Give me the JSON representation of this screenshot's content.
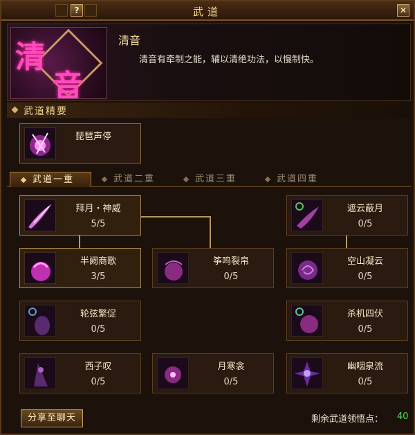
{
  "window": {
    "title": "武道",
    "help_label": "?",
    "close_label": "✕"
  },
  "header": {
    "emblem_chars": [
      "清",
      "音"
    ],
    "school_name": "清音",
    "description": "清音有牵制之能，辅以清绝功法，以慢制快。"
  },
  "section": {
    "title": "武道精要",
    "summary_skill": "琵琶声停"
  },
  "tabs": [
    {
      "label": "武道一重",
      "active": true
    },
    {
      "label": "武道二重",
      "active": false
    },
    {
      "label": "武道三重",
      "active": false
    },
    {
      "label": "武道四重",
      "active": false
    }
  ],
  "skills": [
    {
      "name": "拜月・神威",
      "level": "5/5",
      "icon": "crescent-slash-icon",
      "color": "#d040c0"
    },
    {
      "name": "遮云蔽月",
      "level": "0/5",
      "icon": "cloud-moon-icon",
      "color": "#a03090"
    },
    {
      "name": "半阙商歌",
      "level": "3/5",
      "icon": "magic-hand-icon",
      "color": "#c030b0"
    },
    {
      "name": "筝鸣裂帛",
      "level": "0/5",
      "icon": "zither-hand-icon",
      "color": "#8a2a80"
    },
    {
      "name": "空山凝云",
      "level": "0/5",
      "icon": "swirl-hand-icon",
      "color": "#8a2a90"
    },
    {
      "name": "轮弦繁促",
      "level": "0/5",
      "icon": "moon-figure-icon",
      "color": "#5a2a70"
    },
    {
      "name": "杀机四伏",
      "level": "0/5",
      "icon": "moon-orb-icon",
      "color": "#8a2a80"
    },
    {
      "name": "西子叹",
      "level": "0/5",
      "icon": "veiled-figure-icon",
      "color": "#5a2a70"
    },
    {
      "name": "月寒衾",
      "level": "0/5",
      "icon": "sparkle-orb-icon",
      "color": "#8a2a80"
    },
    {
      "name": "幽咽泉流",
      "level": "0/5",
      "icon": "spirit-burst-icon",
      "color": "#6a2aa0"
    }
  ],
  "footer": {
    "share_label": "分享至聊天",
    "points_label": "剩余武道领悟点：",
    "points_value": "40"
  }
}
